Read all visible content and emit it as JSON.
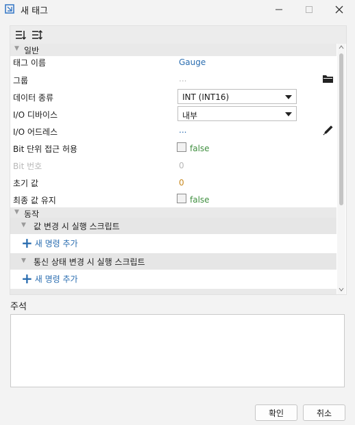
{
  "window": {
    "title": "새 태그"
  },
  "grid": {
    "categories": {
      "general": "일반",
      "behavior": "동작"
    },
    "rows": {
      "tag_name": {
        "label": "태그 이름",
        "value": "Gauge"
      },
      "group": {
        "label": "그룹",
        "value": "..."
      },
      "data_type": {
        "label": "데이터 종류",
        "value": "INT (INT16)"
      },
      "io_device": {
        "label": "I/O 디바이스",
        "value": "내부"
      },
      "io_address": {
        "label": "I/O 어드레스",
        "value": "..."
      },
      "bit_access": {
        "label": "Bit 단위 접근 허용",
        "value": "false"
      },
      "bit_number": {
        "label": "Bit 번호",
        "value": "0"
      },
      "initial": {
        "label": "초기 값",
        "value": "0"
      },
      "retain": {
        "label": "최종 값 유지",
        "value": "false"
      }
    },
    "scripts": [
      {
        "header": "값 변경 시 실행 스크립트",
        "add_label": "새 명령 추가"
      },
      {
        "header": "통신 상태 변경 시 실행 스크립트",
        "add_label": "새 명령 추가"
      }
    ]
  },
  "comment": {
    "label": "주석",
    "value": ""
  },
  "buttons": {
    "ok": "확인",
    "cancel": "취소"
  },
  "colors": {
    "link": "#2a6db0",
    "value_number": "#c8881e",
    "value_bool": "#3f8f3f"
  },
  "icons": [
    "app-icon",
    "minimize-icon",
    "maximize-icon",
    "close-icon",
    "sort-categorized-icon",
    "sort-alphabetical-icon",
    "folder-icon",
    "edit-pencil-icon",
    "plus-icon"
  ]
}
